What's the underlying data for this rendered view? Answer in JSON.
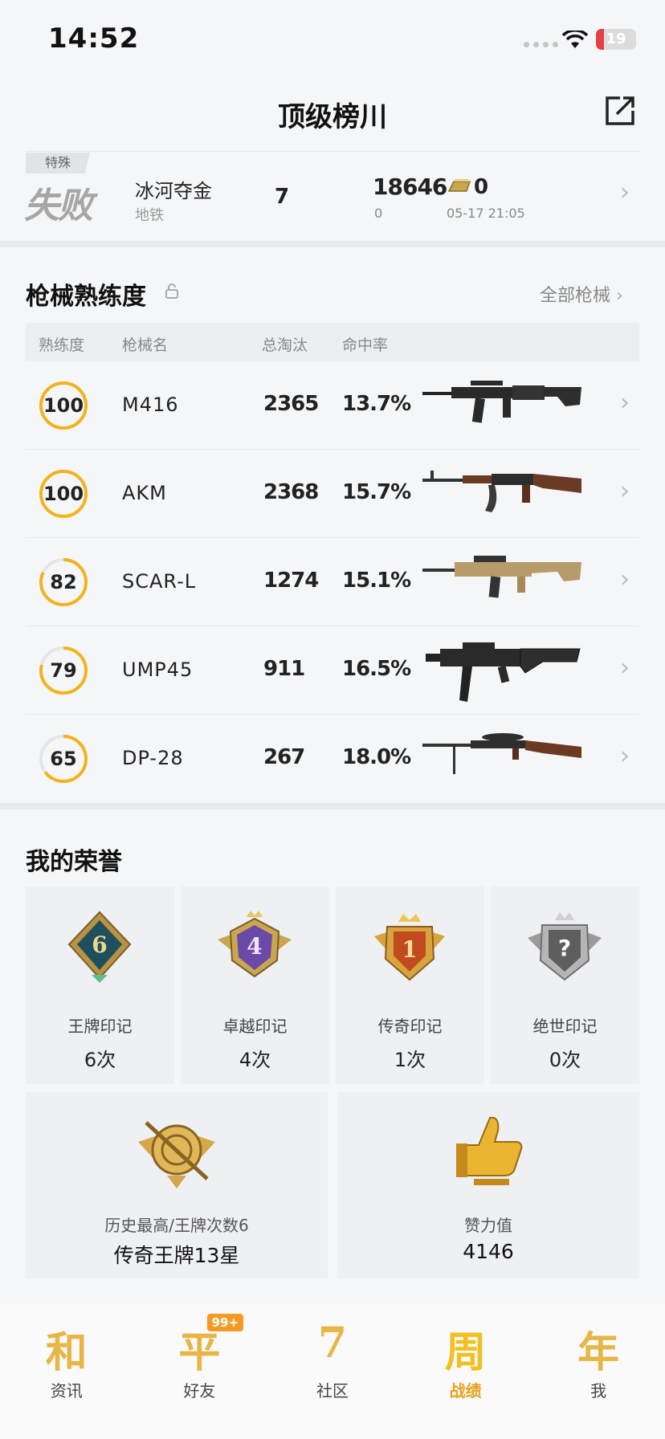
{
  "status_bar": {
    "time": "14:52",
    "battery": "19",
    "battery_level": 0.19
  },
  "header": {
    "title": "顶级榜川"
  },
  "match": {
    "tag": "特殊",
    "result": "失败",
    "map": "冰河夺金",
    "mode": "地铁",
    "rank": "7",
    "score": "18646",
    "score_sub": "0",
    "gold": "0",
    "date": "05-17 21:05"
  },
  "weapons": {
    "title": "枪械熟练度",
    "all_label": "全部枪械",
    "columns": {
      "mastery": "熟练度",
      "name": "枪械名",
      "kills": "总淘汰",
      "accuracy": "命中率"
    },
    "rows": [
      {
        "mastery": "100",
        "mastery_level": 1.0,
        "name": "M416",
        "kills": "2365",
        "accuracy": "13.7%"
      },
      {
        "mastery": "100",
        "mastery_level": 1.0,
        "name": "AKM",
        "kills": "2368",
        "accuracy": "15.7%"
      },
      {
        "mastery": "82",
        "mastery_level": 0.82,
        "name": "SCAR-L",
        "kills": "1274",
        "accuracy": "15.1%"
      },
      {
        "mastery": "79",
        "mastery_level": 0.79,
        "name": "UMP45",
        "kills": "911",
        "accuracy": "16.5%"
      },
      {
        "mastery": "65",
        "mastery_level": 0.65,
        "name": "DP-28",
        "kills": "267",
        "accuracy": "18.0%"
      }
    ]
  },
  "honors": {
    "title": "我的荣誉",
    "badges": [
      {
        "name": "王牌印记",
        "count": "6次",
        "emblem": "6"
      },
      {
        "name": "卓越印记",
        "count": "4次",
        "emblem": "4"
      },
      {
        "name": "传奇印记",
        "count": "1次",
        "emblem": "1"
      },
      {
        "name": "绝世印记",
        "count": "0次",
        "emblem": "?"
      }
    ],
    "best": {
      "label": "历史最高/王牌次数6",
      "value": "传奇王牌13星"
    },
    "likes": {
      "label": "赞力值",
      "value": "4146"
    }
  },
  "tabbar": {
    "items": [
      {
        "glyph": "和",
        "label": "资讯"
      },
      {
        "glyph": "平",
        "label": "好友",
        "badge": "99+"
      },
      {
        "glyph": "7",
        "label": "社区"
      },
      {
        "glyph": "周",
        "label": "战绩"
      },
      {
        "glyph": "年",
        "label": "我"
      }
    ]
  },
  "colors": {
    "accent": "#f2b41c",
    "ring_track": "#e6e6e6"
  }
}
